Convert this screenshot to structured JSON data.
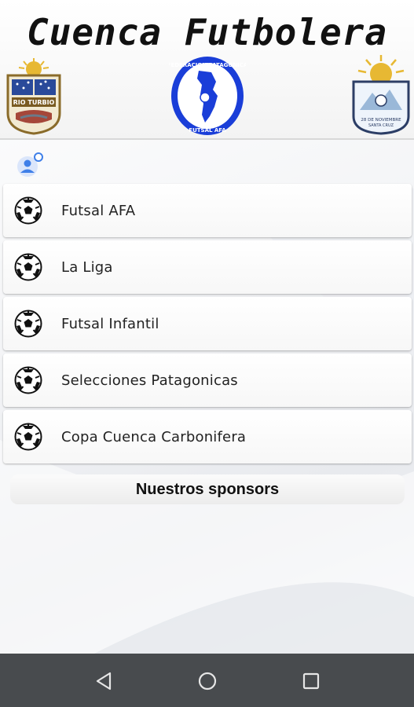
{
  "header": {
    "title": "Cuenca Futbolera",
    "logos": {
      "left": {
        "name": "rio-turbio-crest",
        "text": "RIO TURBIO"
      },
      "center": {
        "name": "federacion-patagonica-futsal-afa-badge",
        "text_top": "FEDERACION PATAGONICA",
        "text_bottom": "FUTSAL AFA"
      },
      "right": {
        "name": "28-de-noviembre-crest",
        "text": "28 DE NOVIEMBRE SANTA CRUZ"
      }
    }
  },
  "user_icon": "account-icon",
  "menu": {
    "items": [
      {
        "label": "Futsal AFA",
        "icon": "soccer-ball-icon"
      },
      {
        "label": "La Liga",
        "icon": "soccer-ball-icon"
      },
      {
        "label": "Futsal Infantil",
        "icon": "soccer-ball-icon"
      },
      {
        "label": "Selecciones Patagonicas",
        "icon": "soccer-ball-icon"
      },
      {
        "label": "Copa Cuenca Carbonifera",
        "icon": "soccer-ball-icon"
      }
    ]
  },
  "sponsors": {
    "label": "Nuestros sponsors"
  },
  "navbar": {
    "back": "back-icon",
    "home": "home-icon",
    "recents": "recents-icon"
  },
  "colors": {
    "accent_blue": "#1a3ed8",
    "navbar_bg": "#484b4e"
  }
}
